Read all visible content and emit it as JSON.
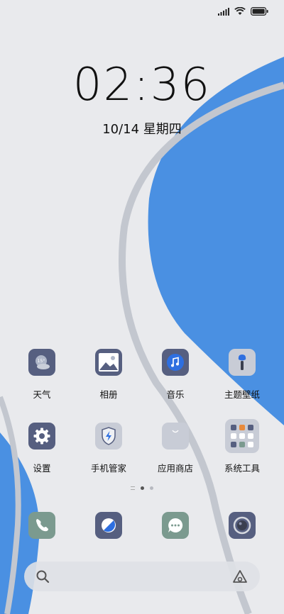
{
  "status": {
    "signal": "signal-icon",
    "wifi": "wifi-icon",
    "battery": "battery-icon"
  },
  "clock": {
    "time": "02:36",
    "date": "10/14 星期四"
  },
  "apps": [
    {
      "label": "天气",
      "icon": "weather-icon",
      "temp": "15°"
    },
    {
      "label": "相册",
      "icon": "gallery-icon"
    },
    {
      "label": "音乐",
      "icon": "music-icon"
    },
    {
      "label": "主题壁纸",
      "icon": "theme-icon"
    },
    {
      "label": "设置",
      "icon": "gear-icon"
    },
    {
      "label": "手机管家",
      "icon": "security-icon"
    },
    {
      "label": "应用商店",
      "icon": "app-store-icon"
    },
    {
      "label": "系统工具",
      "icon": "folder-icon"
    }
  ],
  "dock": [
    "phone-icon",
    "browser-icon",
    "messages-icon",
    "camera-icon"
  ],
  "search": {
    "icon": "search-icon",
    "assistant": "assistant-icon"
  },
  "colors": {
    "accent": "#4a90e2",
    "icon_dark": "#565f80",
    "icon_green": "#7b9a8f",
    "background": "#e9eaed"
  }
}
